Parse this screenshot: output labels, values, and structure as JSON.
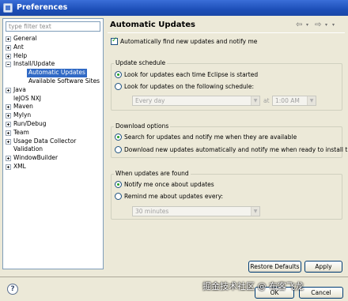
{
  "window": {
    "title": "Preferences"
  },
  "sidebar": {
    "filter_placeholder": "type filter text",
    "items": [
      {
        "label": "General",
        "expander": "plus"
      },
      {
        "label": "Ant",
        "expander": "plus"
      },
      {
        "label": "Help",
        "expander": "plus"
      },
      {
        "label": "Install/Update",
        "expander": "minus"
      },
      {
        "label": "Automatic Updates",
        "expander": "none",
        "selected": true
      },
      {
        "label": "Available Software Sites",
        "expander": "none"
      },
      {
        "label": "Java",
        "expander": "plus"
      },
      {
        "label": "leJOS NXJ",
        "expander": "none"
      },
      {
        "label": "Maven",
        "expander": "plus"
      },
      {
        "label": "Mylyn",
        "expander": "plus"
      },
      {
        "label": "Run/Debug",
        "expander": "plus"
      },
      {
        "label": "Team",
        "expander": "plus"
      },
      {
        "label": "Usage Data Collector",
        "expander": "plus"
      },
      {
        "label": "Validation",
        "expander": "none"
      },
      {
        "label": "WindowBuilder",
        "expander": "plus"
      },
      {
        "label": "XML",
        "expander": "plus"
      }
    ]
  },
  "page": {
    "title": "Automatic Updates",
    "nav_icons": [
      "back-arrow-icon",
      "dropdown-icon",
      "forward-arrow-icon",
      "dropdown-icon"
    ],
    "auto_find_label": "Automatically find new updates and notify me",
    "auto_find_checked": true,
    "schedule": {
      "title": "Update schedule",
      "option_startup": "Look for updates each time Eclipse is started",
      "option_schedule": "Look for updates on the following schedule:",
      "day_value": "Every day",
      "at_label": "at",
      "time_value": "1:00 AM"
    },
    "download": {
      "title": "Download options",
      "option_notify": "Search for updates and notify me when they are available",
      "option_auto": "Download new updates automatically and notify me when ready to install them"
    },
    "found": {
      "title": "When updates are found",
      "option_once": "Notify me once about updates",
      "option_remind": "Remind me about updates every:",
      "remind_value": "30 minutes"
    },
    "restore_label": "Restore Defaults",
    "apply_label": "Apply"
  },
  "footer": {
    "help_label": "?",
    "ok_label": "OK",
    "cancel_label": "Cancel"
  },
  "watermark_text": "掘金技术社区 @ 布客飞龙"
}
